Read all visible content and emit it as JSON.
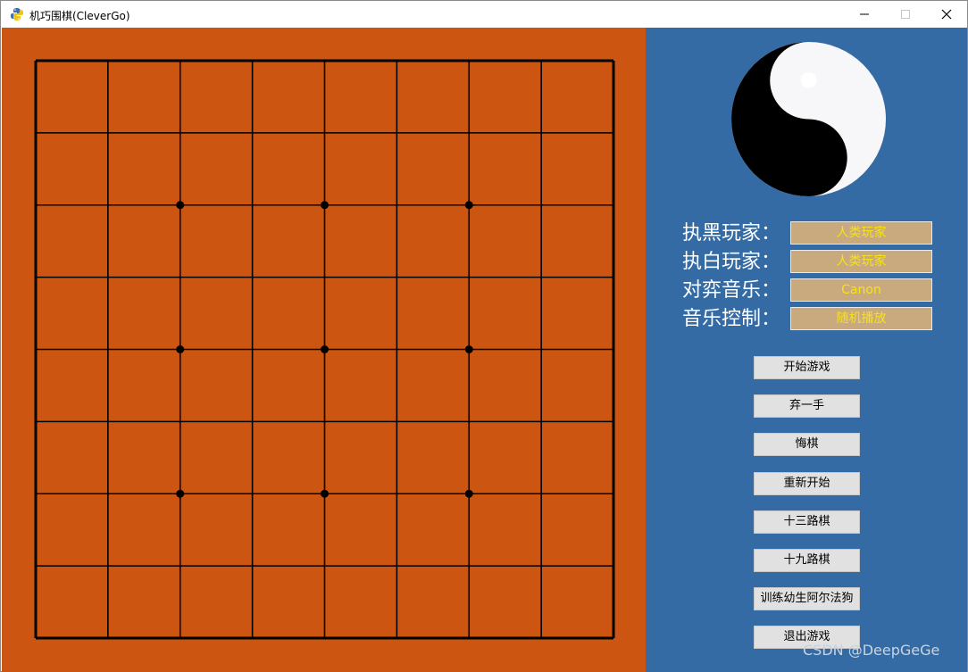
{
  "window": {
    "title": "机巧围棋(CleverGo)",
    "icon": "python-snake-icon",
    "controls": [
      "minimize-icon",
      "maximize-icon",
      "close-icon"
    ]
  },
  "board": {
    "background": "#cc5512",
    "line_color": "#000000",
    "grid_lines": 9,
    "star_points": [
      [
        2,
        2
      ],
      [
        4,
        2
      ],
      [
        6,
        2
      ],
      [
        2,
        4
      ],
      [
        4,
        4
      ],
      [
        6,
        4
      ],
      [
        2,
        6
      ],
      [
        4,
        6
      ],
      [
        6,
        6
      ]
    ]
  },
  "panel": {
    "background": "#356ba4",
    "emblem": "yin-yang-icon",
    "settings": [
      {
        "label": "执黑玩家：",
        "value": "人类玩家"
      },
      {
        "label": "执白玩家：",
        "value": "人类玩家"
      },
      {
        "label": "对弈音乐：",
        "value": "Canon"
      },
      {
        "label": "音乐控制：",
        "value": "随机播放"
      }
    ],
    "buttons": [
      "开始游戏",
      "弃一手",
      "悔棋",
      "重新开始",
      "十三路棋",
      "十九路棋",
      "训练幼生阿尔法狗",
      "退出游戏"
    ],
    "watermark": "CSDN @DeepGeGe"
  }
}
